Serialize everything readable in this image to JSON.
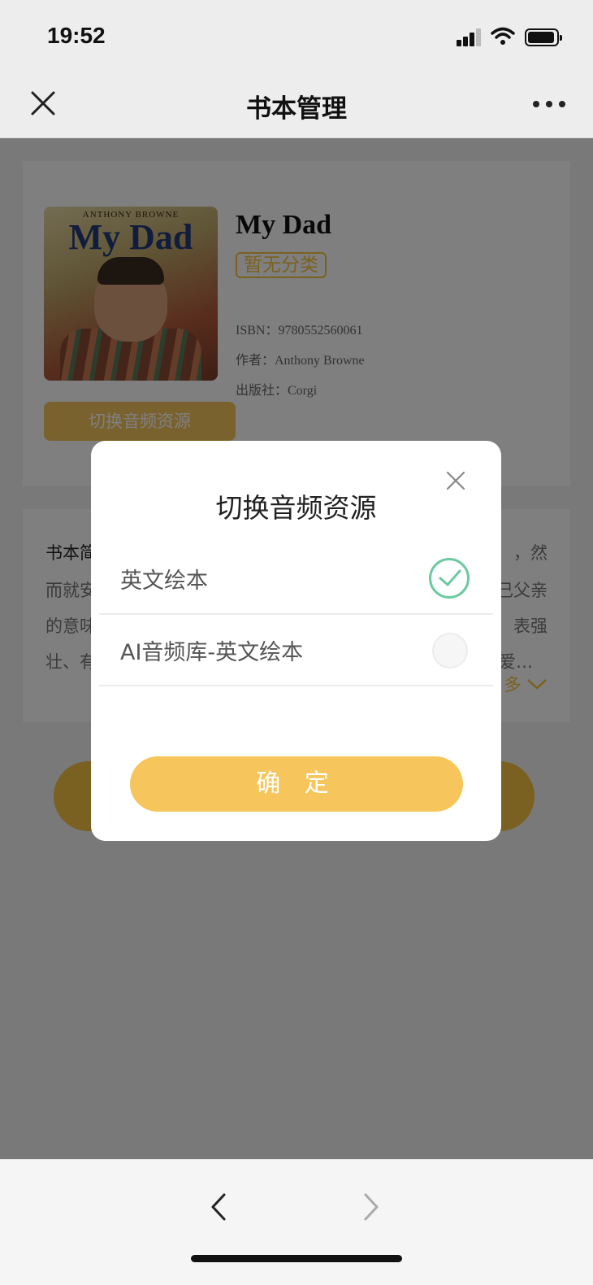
{
  "status_bar": {
    "time": "19:52"
  },
  "nav": {
    "title": "书本管理"
  },
  "book": {
    "cover_author": "ANTHONY BROWNE",
    "cover_title": "My Dad",
    "title": "My Dad",
    "category": "暂无分类",
    "isbn": "ISBN：9780552560061",
    "author": "作者：Anthony Browne",
    "publisher": "出版社：Corgi",
    "switch_button": "切换音频资源"
  },
  "description": {
    "label": "书本简",
    "lines_left": [
      "",
      "而就安",
      "的意味",
      "壮、有"
    ],
    "lines_right": [
      "，然",
      "己父亲",
      "表强",
      "爱…"
    ],
    "more": "多"
  },
  "modal": {
    "title": "切换音频资源",
    "options": [
      {
        "label": "英文绘本",
        "selected": true
      },
      {
        "label": "AI音频库-英文绘本",
        "selected": false
      }
    ],
    "confirm": "确 定"
  },
  "colors": {
    "accent": "#f5c342",
    "check": "#6ccaa0",
    "overlay": "rgba(0,0,0,0.5)"
  },
  "icons": [
    "close-icon",
    "more-icon",
    "check-icon",
    "back-arrow-icon",
    "forward-arrow-icon"
  ]
}
